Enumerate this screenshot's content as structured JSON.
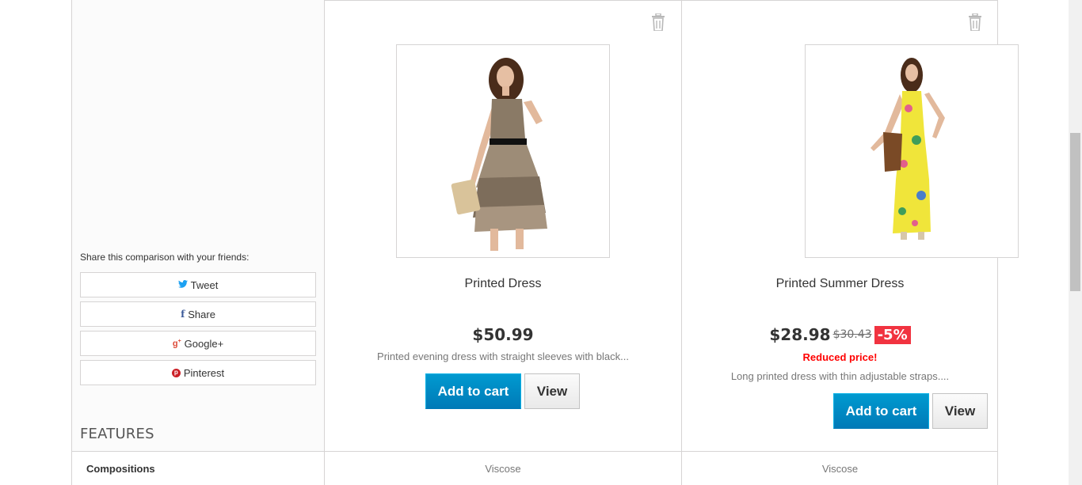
{
  "share": {
    "title": "Share this comparison with your friends:",
    "buttons": [
      {
        "label": "Tweet",
        "icon": "twitter-icon"
      },
      {
        "label": "Share",
        "icon": "facebook-icon"
      },
      {
        "label": "Google+",
        "icon": "google-plus-icon"
      },
      {
        "label": "Pinterest",
        "icon": "pinterest-icon"
      }
    ]
  },
  "features_heading": "FEATURES",
  "products": [
    {
      "name": "Printed Dress",
      "price": "$50.99",
      "description": "Printed evening dress with straight sleeves with black...",
      "add_to_cart": "Add to cart",
      "view": "View"
    },
    {
      "name": "Printed Summer Dress",
      "price": "$28.98",
      "old_price": "$30.43",
      "discount": "-5%",
      "reduced_label": "Reduced price!",
      "description": "Long printed dress with thin adjustable straps....",
      "add_to_cart": "Add to cart",
      "view": "View"
    }
  ],
  "features": [
    {
      "label": "Compositions",
      "values": [
        "Viscose",
        "Viscose"
      ]
    }
  ],
  "colors": {
    "cart_button": "#0089c4",
    "discount_badge": "#f13340",
    "reduced_price": "#ff0000"
  }
}
